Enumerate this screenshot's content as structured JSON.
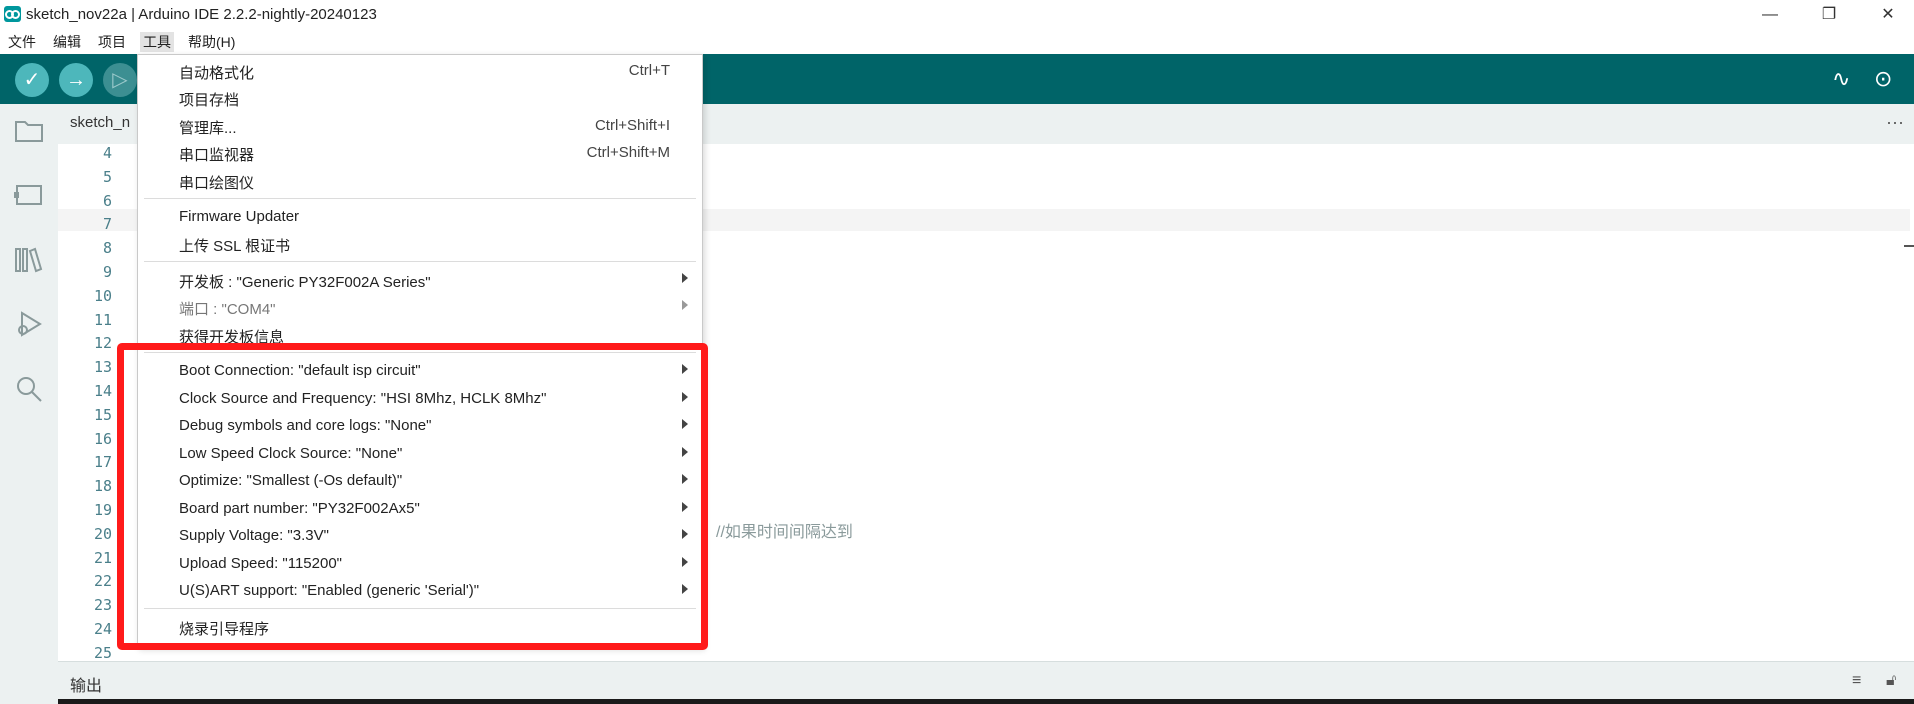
{
  "window": {
    "title": "sketch_nov22a | Arduino IDE 2.2.2-nightly-20240123",
    "minimize": "—",
    "maximize": "❐",
    "close": "✕"
  },
  "menubar": {
    "items": [
      "文件",
      "编辑",
      "项目",
      "工具",
      "帮助(H)"
    ],
    "active": "工具"
  },
  "toolbar": {
    "verify": "✓",
    "upload": "→",
    "debug": "▷",
    "serial_plotter": "∿",
    "serial_monitor": "⊙"
  },
  "tab": {
    "label": "sketch_n"
  },
  "editor": {
    "line_numbers": [
      "4",
      "5",
      "6",
      "7",
      "8",
      "9",
      "10",
      "11",
      "12",
      "13",
      "14",
      "15",
      "16",
      "17",
      "18",
      "19",
      "20",
      "21",
      "22",
      "23",
      "24",
      "25"
    ],
    "visible_comment": "//如果时间间隔达到"
  },
  "output": {
    "label": "输出"
  },
  "tools_menu": {
    "group1": [
      {
        "label": "自动格式化",
        "shortcut": "Ctrl+T"
      },
      {
        "label": "项目存档",
        "shortcut": ""
      },
      {
        "label": "管理库...",
        "shortcut": "Ctrl+Shift+I"
      },
      {
        "label": "串口监视器",
        "shortcut": "Ctrl+Shift+M"
      },
      {
        "label": "串口绘图仪",
        "shortcut": ""
      }
    ],
    "group2": [
      {
        "label": "Firmware Updater"
      },
      {
        "label": "上传 SSL 根证书"
      }
    ],
    "group3": [
      {
        "label": "开发板 : \"Generic PY32F002A Series\""
      },
      {
        "label": "端口 : \"COM4\""
      },
      {
        "label": "获得开发板信息"
      }
    ],
    "group4": [
      {
        "label": "Boot Connection: \"default isp circuit\""
      },
      {
        "label": "Clock Source and Frequency: \"HSI 8Mhz, HCLK 8Mhz\""
      },
      {
        "label": "Debug symbols and core logs: \"None\""
      },
      {
        "label": "Low Speed Clock Source: \"None\""
      },
      {
        "label": "Optimize: \"Smallest (-Os default)\""
      },
      {
        "label": "Board part number: \"PY32F002Ax5\""
      },
      {
        "label": "Supply Voltage: \"3.3V\""
      },
      {
        "label": "Upload Speed: \"115200\""
      },
      {
        "label": "U(S)ART support: \"Enabled (generic 'Serial')\""
      }
    ],
    "group5": [
      {
        "label": "烧录引导程序"
      }
    ]
  },
  "colors": {
    "toolbar_bg": "#006468",
    "toolbar_btn": "#4db7bb",
    "sidebar_bg": "#ecf1f1",
    "highlight_box": "#ff1a1a"
  }
}
